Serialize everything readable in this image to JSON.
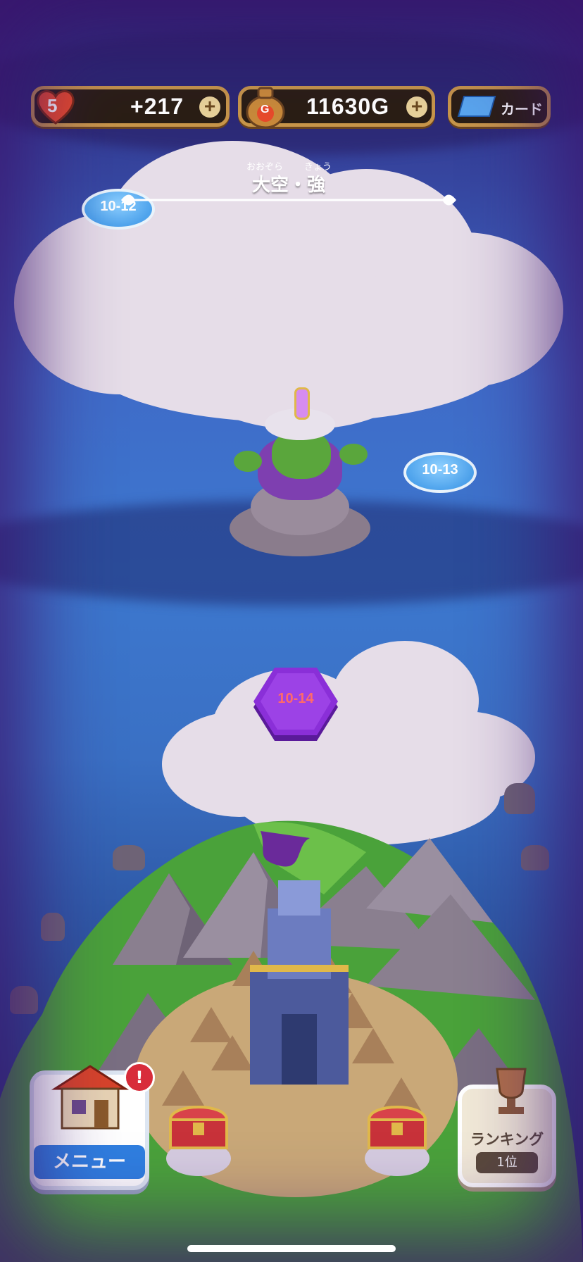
{
  "hud": {
    "lives_count": "5",
    "lives_value": "+217",
    "gold_icon_letter": "G",
    "gold_value": "11630G",
    "card_label": "カード",
    "add_symbol": "+"
  },
  "area": {
    "title": "大空・強",
    "ruby_left": "おおぞら",
    "ruby_right": "きょう"
  },
  "stages": {
    "s12": "10-12",
    "s13": "10-13",
    "s14": "10-14"
  },
  "bottom": {
    "menu_label": "メニュー",
    "alert_mark": "!",
    "ranking_label": "ランキング",
    "ranking_rank": "1位"
  },
  "colors": {
    "hud_border": "#c8964a",
    "stage_blue": "#4ea3ec",
    "boss_purple": "#8a2fd8",
    "alert_red": "#d82c3a"
  }
}
